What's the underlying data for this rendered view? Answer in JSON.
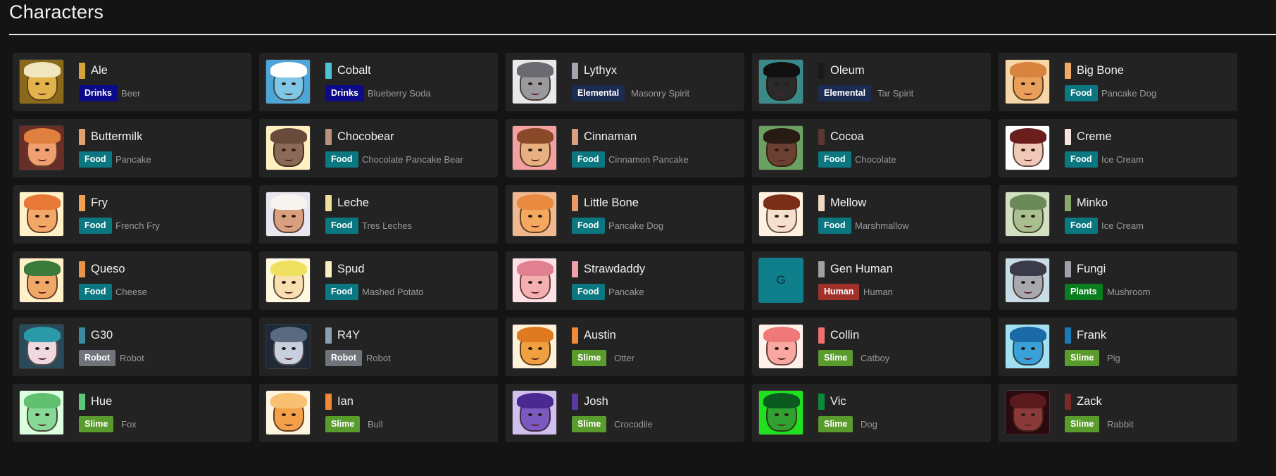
{
  "page": {
    "title": "Characters"
  },
  "colors": {
    "Drinks": "#0b0a8a",
    "Elemental": "#1c2b52",
    "Food": "#0b7780",
    "Human": "#a3312b",
    "Plants": "#0a7d1f",
    "Robot": "#6f737a",
    "Slime": "#5a9b2e"
  },
  "characters": [
    {
      "name": "Ale",
      "category": "Drinks",
      "subtype": "Beer",
      "swatch": "#d4a33a",
      "avatar_bg": "#8a6a1a",
      "skin": "#e2b34a",
      "hair": "#f0e6c0"
    },
    {
      "name": "Cobalt",
      "category": "Drinks",
      "subtype": "Blueberry Soda",
      "swatch": "#4fc3d6",
      "avatar_bg": "#4ea6d8",
      "skin": "#7fc7e6",
      "hair": "#ffffff"
    },
    {
      "name": "Lythyx",
      "category": "Elemental",
      "subtype": "Masonry Spirit",
      "swatch": "#a4a4b0",
      "avatar_bg": "#e8e8ea",
      "skin": "#9a9a9e",
      "hair": "#6a6a70"
    },
    {
      "name": "Oleum",
      "category": "Elemental",
      "subtype": "Tar Spirit",
      "swatch": "#1a1a1a",
      "avatar_bg": "#3a8a8a",
      "skin": "#2a2a2a",
      "hair": "#111111"
    },
    {
      "name": "Big Bone",
      "category": "Food",
      "subtype": "Pancake Dog",
      "swatch": "#f0a868",
      "avatar_bg": "#f6d6a6",
      "skin": "#e8a05a",
      "hair": "#d8843e"
    },
    {
      "name": "Buttermilk",
      "category": "Food",
      "subtype": "Pancake",
      "swatch": "#e0a070",
      "avatar_bg": "#6a2e28",
      "skin": "#f0a070",
      "hair": "#e0803e"
    },
    {
      "name": "Chocobear",
      "category": "Food",
      "subtype": "Chocolate Pancake Bear",
      "swatch": "#b8927a",
      "avatar_bg": "#fff0c0",
      "skin": "#8a6a56",
      "hair": "#6a4a3a"
    },
    {
      "name": "Cinnaman",
      "category": "Food",
      "subtype": "Cinnamon Pancake",
      "swatch": "#d8a07e",
      "avatar_bg": "#f4a0a0",
      "skin": "#e8b080",
      "hair": "#8a4a2a"
    },
    {
      "name": "Cocoa",
      "category": "Food",
      "subtype": "Chocolate",
      "swatch": "#5a3a30",
      "avatar_bg": "#6aa060",
      "skin": "#6a4030",
      "hair": "#2a1a14"
    },
    {
      "name": "Creme",
      "category": "Food",
      "subtype": "Ice Cream",
      "swatch": "#f4e4dc",
      "avatar_bg": "#ffffff",
      "skin": "#f0c8b8",
      "hair": "#6a1e1e"
    },
    {
      "name": "Fry",
      "category": "Food",
      "subtype": "French Fry",
      "swatch": "#f0a050",
      "avatar_bg": "#fff0c8",
      "skin": "#f4a868",
      "hair": "#e87838"
    },
    {
      "name": "Leche",
      "category": "Food",
      "subtype": "Tres Leches",
      "swatch": "#f0e0a0",
      "avatar_bg": "#e8e6ee",
      "skin": "#d8a080",
      "hair": "#f8f4f0"
    },
    {
      "name": "Little Bone",
      "category": "Food",
      "subtype": "Pancake Dog",
      "swatch": "#e89a60",
      "avatar_bg": "#f0b890",
      "skin": "#f4a860",
      "hair": "#e88a40"
    },
    {
      "name": "Mellow",
      "category": "Food",
      "subtype": "Marshmallow",
      "swatch": "#f0d8c4",
      "avatar_bg": "#fff0e0",
      "skin": "#f4e0cc",
      "hair": "#7a2e18"
    },
    {
      "name": "Minko",
      "category": "Food",
      "subtype": "Ice Cream",
      "swatch": "#88a870",
      "avatar_bg": "#d0e0c0",
      "skin": "#a8c090",
      "hair": "#6a8a58"
    },
    {
      "name": "Queso",
      "category": "Food",
      "subtype": "Cheese",
      "swatch": "#e8924a",
      "avatar_bg": "#fff0c8",
      "skin": "#f0a868",
      "hair": "#3a7a3a"
    },
    {
      "name": "Spud",
      "category": "Food",
      "subtype": "Mashed Potato",
      "swatch": "#f8f0c0",
      "avatar_bg": "#fff8e0",
      "skin": "#f8e0b0",
      "hair": "#f0e060"
    },
    {
      "name": "Strawdaddy",
      "category": "Food",
      "subtype": "Pancake",
      "swatch": "#f0a0a8",
      "avatar_bg": "#ffe0e6",
      "skin": "#f4b0b0",
      "hair": "#e08090"
    },
    {
      "name": "Gen Human",
      "category": "Human",
      "subtype": "Human",
      "swatch": "#a0a0a0",
      "avatar_bg": "#0e7e8a",
      "letter": "G"
    },
    {
      "name": "Fungi",
      "category": "Plants",
      "subtype": "Mushroom",
      "swatch": "#a0a0a8",
      "avatar_bg": "#c8dce6",
      "skin": "#a8a8b0",
      "hair": "#3a3a48"
    },
    {
      "name": "G30",
      "category": "Robot",
      "subtype": "Robot",
      "swatch": "#3a8aa0",
      "avatar_bg": "#2a4a5a",
      "skin": "#f0d8e0",
      "hair": "#2a9aa8"
    },
    {
      "name": "R4Y",
      "category": "Robot",
      "subtype": "Robot",
      "swatch": "#8aa0b0",
      "avatar_bg": "#1e2a36",
      "skin": "#c8d0e0",
      "hair": "#5a6a80"
    },
    {
      "name": "Austin",
      "category": "Slime",
      "subtype": "Otter",
      "swatch": "#f08a38",
      "avatar_bg": "#fff0d8",
      "skin": "#f0a040",
      "hair": "#e07a20"
    },
    {
      "name": "Collin",
      "category": "Slime",
      "subtype": "Catboy",
      "swatch": "#f07070",
      "avatar_bg": "#fff0ea",
      "skin": "#f8a8a0",
      "hair": "#f07878"
    },
    {
      "name": "Frank",
      "category": "Slime",
      "subtype": "Pig",
      "swatch": "#1a7ab8",
      "avatar_bg": "#a0e0f0",
      "skin": "#3aa0d8",
      "hair": "#1a6aa8"
    },
    {
      "name": "Hue",
      "category": "Slime",
      "subtype": "Fox",
      "swatch": "#5ac878",
      "avatar_bg": "#dcffe0",
      "skin": "#88d898",
      "hair": "#60c070"
    },
    {
      "name": "Ian",
      "category": "Slime",
      "subtype": "Bull",
      "swatch": "#f08838",
      "avatar_bg": "#fff4e0",
      "skin": "#f4a048",
      "hair": "#f8c070"
    },
    {
      "name": "Josh",
      "category": "Slime",
      "subtype": "Crocodile",
      "swatch": "#5a3aa0",
      "avatar_bg": "#d0c0f0",
      "skin": "#7a5ac0",
      "hair": "#4a2a90"
    },
    {
      "name": "Vic",
      "category": "Slime",
      "subtype": "Dog",
      "swatch": "#0a8a3a",
      "avatar_bg": "#20e020",
      "skin": "#30a030",
      "hair": "#0a5a20"
    },
    {
      "name": "Zack",
      "category": "Slime",
      "subtype": "Rabbit",
      "swatch": "#7a2a2a",
      "avatar_bg": "#2a0a0e",
      "skin": "#8a3a3a",
      "hair": "#5a1a1e"
    }
  ]
}
